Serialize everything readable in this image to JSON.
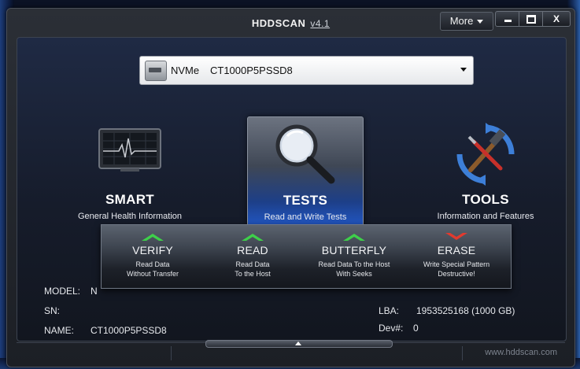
{
  "window": {
    "title": "HDDSCAN",
    "version": "v4.1",
    "more_label": "More",
    "close_glyph": "X"
  },
  "device": {
    "type": "NVMe",
    "model": "CT1000P5PSSD8"
  },
  "tiles": {
    "smart": {
      "label": "SMART",
      "sub": "General Health Information"
    },
    "tests": {
      "label": "TESTS",
      "sub": "Read and Write Tests"
    },
    "tools": {
      "label": "TOOLS",
      "sub": "Information and Features"
    }
  },
  "test_menu": [
    {
      "title": "VERIFY",
      "line1": "Read Data",
      "line2": "Without Transfer",
      "arrow": "up",
      "color": "#3ecf4a"
    },
    {
      "title": "READ",
      "line1": "Read Data",
      "line2": "To the Host",
      "arrow": "up",
      "color": "#3ecf4a"
    },
    {
      "title": "BUTTERFLY",
      "line1": "Read Data To the Host",
      "line2": "With Seeks",
      "arrow": "up",
      "color": "#3ecf4a"
    },
    {
      "title": "ERASE",
      "line1": "Write Special Pattern",
      "line2": "Destructive!",
      "arrow": "down",
      "color": "#e23a2e"
    }
  ],
  "info": {
    "model_label": "MODEL:",
    "model_value": "N",
    "sn_label": "SN:",
    "sn_value": "",
    "name_label": "NAME:",
    "name_value": "CT1000P5PSSD8",
    "lba_label": "LBA:",
    "lba_value": "1953525168 (1000 GB)",
    "dev_label": "Dev#:",
    "dev_value": "0"
  },
  "footer": {
    "url": "www.hddscan.com"
  }
}
